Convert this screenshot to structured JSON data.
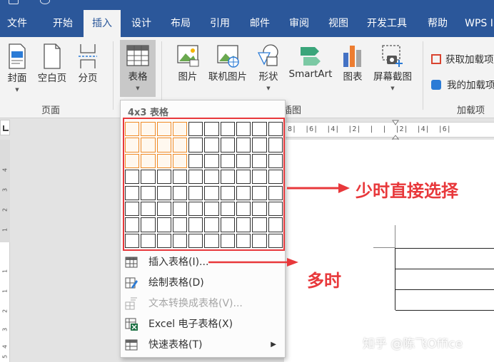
{
  "menu": {
    "tabs": [
      {
        "label": "文件"
      },
      {
        "label": "开始"
      },
      {
        "label": "插入"
      },
      {
        "label": "设计"
      },
      {
        "label": "布局"
      },
      {
        "label": "引用"
      },
      {
        "label": "邮件"
      },
      {
        "label": "审阅"
      },
      {
        "label": "视图"
      },
      {
        "label": "开发工具"
      },
      {
        "label": "帮助"
      },
      {
        "label": "WPS I"
      }
    ],
    "active_tab": "插入"
  },
  "ribbon": {
    "pages": {
      "cover": "封面",
      "blank": "空白页",
      "break": "分页",
      "group": "页面"
    },
    "table": {
      "label": "表格"
    },
    "illustrations": {
      "picture": "图片",
      "online_picture": "联机图片",
      "shapes": "形状",
      "smartart": "SmartArt",
      "chart": "图表",
      "screenshot": "屏幕截图",
      "group": "插图"
    },
    "addins": {
      "get": "获取加载项",
      "mine": "我的加载项",
      "group": "加载项"
    }
  },
  "ruler": {
    "horizontal": " 8|  |6|  |4|  |2|  |  |  |2|  |4|  |6|",
    "vertical": [
      "4",
      "3",
      "2",
      "1",
      "1",
      "1",
      "2",
      "3",
      "4",
      "5"
    ]
  },
  "dropdown": {
    "title": "4x3 表格",
    "grid_cols": 10,
    "grid_rows": 8,
    "selected_cols": 4,
    "selected_rows": 3,
    "items": [
      {
        "label": "插入表格(I)...",
        "disabled": false,
        "submenu": false
      },
      {
        "label": "绘制表格(D)",
        "disabled": false,
        "submenu": false
      },
      {
        "label": "文本转换成表格(V)...",
        "disabled": true,
        "submenu": false
      },
      {
        "label": "Excel 电子表格(X)",
        "disabled": false,
        "submenu": false
      },
      {
        "label": "快速表格(T)",
        "disabled": false,
        "submenu": true
      }
    ]
  },
  "annotations": {
    "few": "少时直接选择",
    "many": "多时"
  },
  "watermark": "知乎 @陈飞Office",
  "colors": {
    "ribbon_blue": "#2b579a",
    "annotation_red": "#e8383b",
    "selection_orange": "#f08a24"
  }
}
